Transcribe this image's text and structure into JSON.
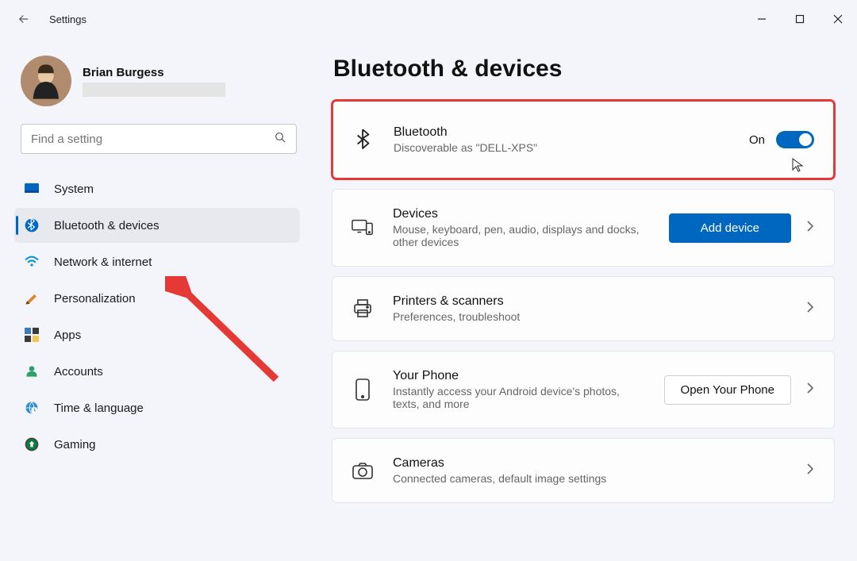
{
  "window": {
    "title": "Settings"
  },
  "user": {
    "name": "Brian Burgess"
  },
  "search": {
    "placeholder": "Find a setting"
  },
  "nav": {
    "items": [
      {
        "label": "System"
      },
      {
        "label": "Bluetooth & devices"
      },
      {
        "label": "Network & internet"
      },
      {
        "label": "Personalization"
      },
      {
        "label": "Apps"
      },
      {
        "label": "Accounts"
      },
      {
        "label": "Time & language"
      },
      {
        "label": "Gaming"
      }
    ]
  },
  "page": {
    "title": "Bluetooth & devices"
  },
  "panels": {
    "bluetooth": {
      "title": "Bluetooth",
      "sub": "Discoverable as \"DELL-XPS\"",
      "toggle_state": "On"
    },
    "devices": {
      "title": "Devices",
      "sub": "Mouse, keyboard, pen, audio, displays and docks, other devices",
      "button": "Add device"
    },
    "printers": {
      "title": "Printers & scanners",
      "sub": "Preferences, troubleshoot"
    },
    "phone": {
      "title": "Your Phone",
      "sub": "Instantly access your Android device's photos, texts, and more",
      "button": "Open Your Phone"
    },
    "cameras": {
      "title": "Cameras",
      "sub": "Connected cameras, default image settings"
    }
  }
}
